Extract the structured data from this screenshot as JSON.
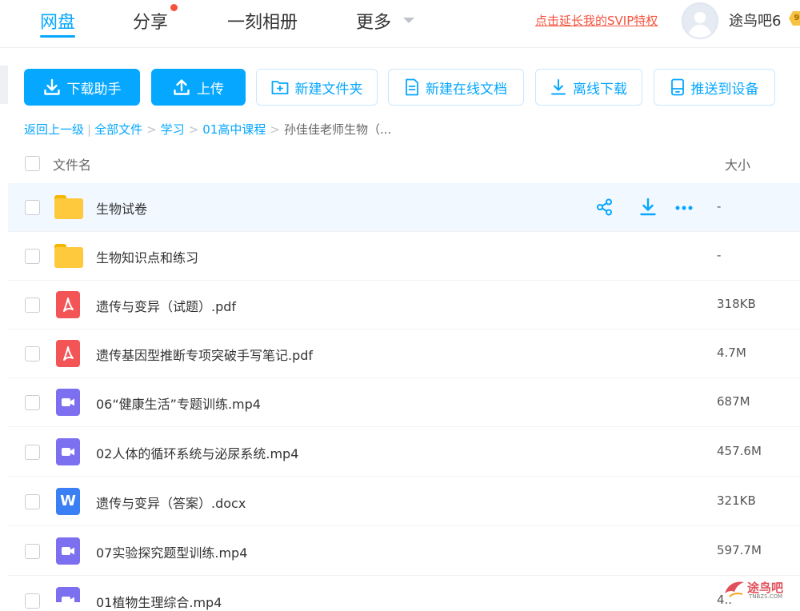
{
  "nav": {
    "items": [
      "网盘",
      "分享",
      "一刻相册",
      "更多"
    ],
    "svip_link": "点击延长我的SVIP特权",
    "username": "途鸟吧6",
    "vip_badge": "9"
  },
  "toolbar": {
    "download_helper": "下载助手",
    "upload": "上传",
    "new_folder": "新建文件夹",
    "new_online_doc": "新建在线文档",
    "offline_download": "离线下载",
    "push_to_device": "推送到设备"
  },
  "breadcrumb": {
    "back": "返回上一级",
    "divider": "|",
    "items": [
      "全部文件",
      "学习",
      "01高中课程"
    ],
    "current": "孙佳佳老师生物（...",
    "sep": ">"
  },
  "list": {
    "col_name": "文件名",
    "col_size": "大小",
    "rows": [
      {
        "name": "生物试卷",
        "size": "-",
        "type": "folder"
      },
      {
        "name": "生物知识点和练习",
        "size": "-",
        "type": "folder"
      },
      {
        "name": "遗传与变异（试题）.pdf",
        "size": "318KB",
        "type": "pdf"
      },
      {
        "name": "遗传基因型推断专项突破手写笔记.pdf",
        "size": "4.7M",
        "type": "pdf"
      },
      {
        "name": "06“健康生活”专题训练.mp4",
        "size": "687M",
        "type": "video"
      },
      {
        "name": "02人体的循环系统与泌尿系统.mp4",
        "size": "457.6M",
        "type": "video"
      },
      {
        "name": "遗传与变异（答案）.docx",
        "size": "321KB",
        "type": "word"
      },
      {
        "name": "07实验探究题型训练.mp4",
        "size": "597.7M",
        "type": "video"
      },
      {
        "name": "01植物生理综合.mp4",
        "size": "4..",
        "type": "video"
      }
    ]
  },
  "watermark": {
    "text": "途鸟吧",
    "sub": "TNBZS.COM"
  },
  "colors": {
    "accent": "#06a7ff",
    "svip": "#f5523e",
    "folder": "#ffc93e"
  }
}
